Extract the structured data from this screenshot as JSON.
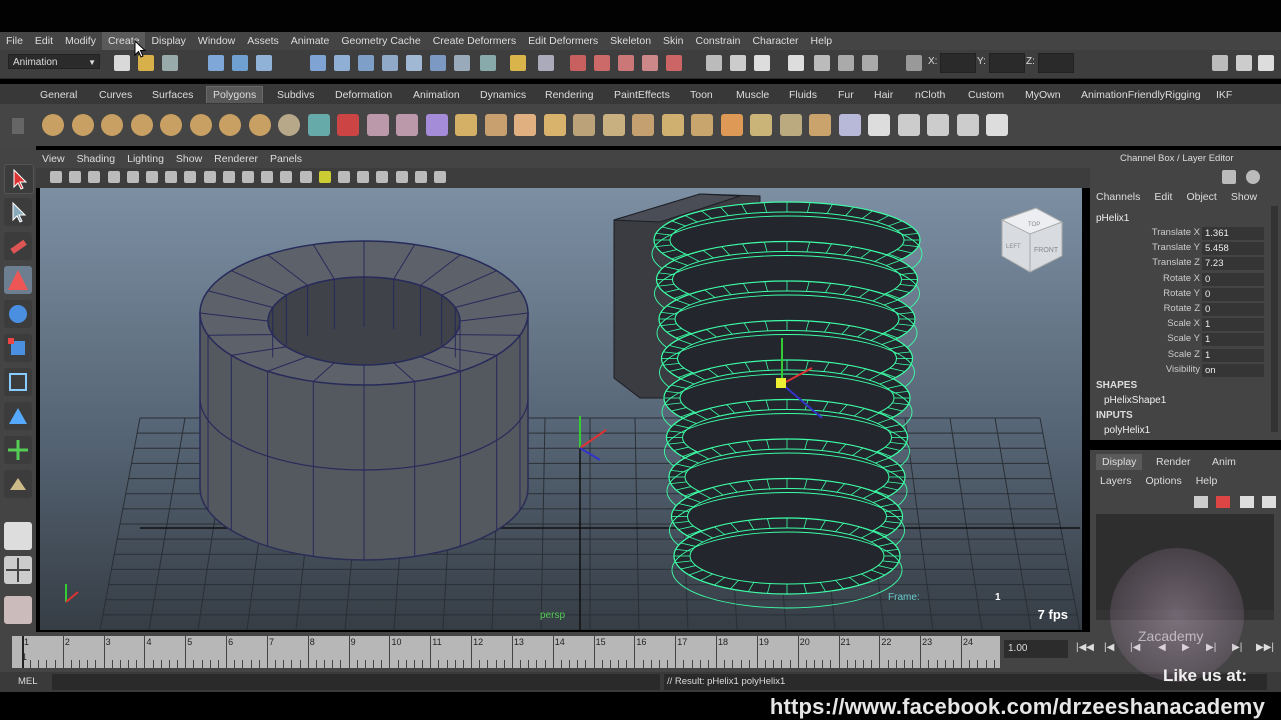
{
  "menubar": [
    "File",
    "Edit",
    "Modify",
    "Create",
    "Display",
    "Window",
    "Assets",
    "Animate",
    "Geometry Cache",
    "Create Deformers",
    "Edit Deformers",
    "Skeleton",
    "Skin",
    "Constrain",
    "Character",
    "Help"
  ],
  "active_menu": "Create",
  "statusline": {
    "mode": "Animation",
    "coord_labels": [
      "X:",
      "Y:",
      "Z:"
    ]
  },
  "shelf_tabs": [
    "General",
    "Curves",
    "Surfaces",
    "Polygons",
    "Subdivs",
    "Deformation",
    "Animation",
    "Dynamics",
    "Rendering",
    "PaintEffects",
    "Toon",
    "Muscle",
    "Fluids",
    "Fur",
    "Hair",
    "nCloth",
    "Custom",
    "MyOwn",
    "AnimationFriendlyRigging",
    "IKF"
  ],
  "active_shelf": "Polygons",
  "panel_menu": [
    "View",
    "Shading",
    "Lighting",
    "Show",
    "Renderer",
    "Panels"
  ],
  "viewport": {
    "camera_label": "persp",
    "frame_label": "Frame:",
    "frame_value": "1",
    "fps": "7 fps",
    "viewcube_top": "TOP",
    "viewcube_front": "FRONT",
    "viewcube_left": "LEFT"
  },
  "channel_box": {
    "title": "Channel Box / Layer Editor",
    "menu": [
      "Channels",
      "Edit",
      "Object",
      "Show"
    ],
    "node": "pHelix1",
    "attributes": [
      {
        "name": "Translate X",
        "value": "1.361"
      },
      {
        "name": "Translate Y",
        "value": "5.458"
      },
      {
        "name": "Translate Z",
        "value": "7.23"
      },
      {
        "name": "Rotate X",
        "value": "0"
      },
      {
        "name": "Rotate Y",
        "value": "0"
      },
      {
        "name": "Rotate Z",
        "value": "0"
      },
      {
        "name": "Scale X",
        "value": "1"
      },
      {
        "name": "Scale Y",
        "value": "1"
      },
      {
        "name": "Scale Z",
        "value": "1"
      },
      {
        "name": "Visibility",
        "value": "on"
      }
    ],
    "shapes_label": "SHAPES",
    "shape_node": "pHelixShape1",
    "inputs_label": "INPUTS",
    "input_node": "polyHelix1"
  },
  "layer_editor": {
    "tabs": [
      "Display",
      "Render",
      "Anim"
    ],
    "active_tab": "Display",
    "menu": [
      "Layers",
      "Options",
      "Help"
    ]
  },
  "timeslider": {
    "ticks": [
      "1",
      "2",
      "3",
      "4",
      "5",
      "6",
      "7",
      "8",
      "9",
      "10",
      "11",
      "12",
      "13",
      "14",
      "15",
      "16",
      "17",
      "18",
      "19",
      "20",
      "21",
      "22",
      "23",
      "24"
    ],
    "current_frame": "1",
    "field_value": "1.00"
  },
  "command_line": {
    "label": "MEL",
    "result": "// Result: pHelix1 polyHelix1"
  },
  "overlay": {
    "url": "https://www.facebook.com/drzeeshanacademy",
    "like": "Like us at:",
    "watermark": "Zacademy"
  },
  "colors": {
    "helix_wire": "#3dffa8",
    "menu_bg": "#444444",
    "viewport_top": "#7c8fa3"
  }
}
